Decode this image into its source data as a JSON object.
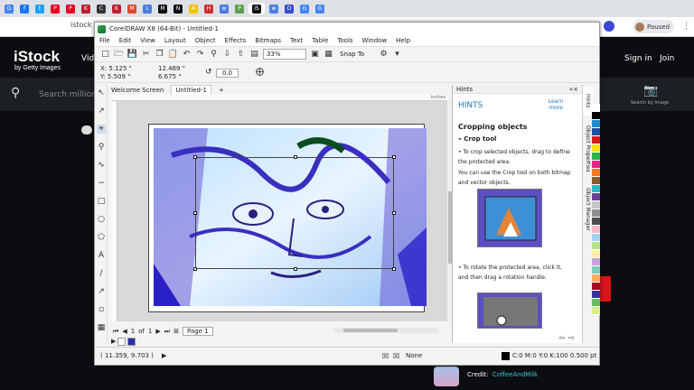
{
  "browser": {
    "tabs": [
      {
        "icon": "G",
        "color": "#4285f4"
      },
      {
        "icon": "f",
        "color": "#1877f2"
      },
      {
        "icon": "t",
        "color": "#1da1f2"
      },
      {
        "icon": "P",
        "color": "#e60023"
      },
      {
        "icon": "P",
        "color": "#e60023"
      },
      {
        "icon": "K",
        "color": "#bd2031"
      },
      {
        "icon": "C",
        "color": "#333333"
      },
      {
        "icon": "K",
        "color": "#bd2031"
      },
      {
        "icon": "M",
        "color": "#e1492a"
      },
      {
        "icon": "L",
        "color": "#4a7ee0"
      },
      {
        "icon": "M",
        "color": "#111111"
      },
      {
        "icon": "N",
        "color": "#111111"
      },
      {
        "icon": "A",
        "color": "#f2c200"
      },
      {
        "icon": "H",
        "color": "#cc2f2f"
      },
      {
        "icon": "w",
        "color": "#4a7ee0"
      },
      {
        "icon": "P",
        "color": "#5e9e4e"
      },
      {
        "icon": "iS",
        "color": "#111111"
      },
      {
        "icon": "w",
        "color": "#4a7ee0"
      },
      {
        "icon": "D",
        "color": "#3a4bd1"
      },
      {
        "icon": "G",
        "color": "#4285f4"
      },
      {
        "icon": "G",
        "color": "#4285f4"
      }
    ],
    "url": "istock",
    "profile_status": "Paused"
  },
  "istock": {
    "logo": "iStock",
    "logo_sub": "by Getty Images",
    "nav_partial": "Vid",
    "sign_in": "Sign in",
    "join": "Join",
    "search_placeholder": "Search millions",
    "search_by_image": "Search by image",
    "credit_label": "Credit:",
    "credit_name": "CoffeeAndMilk"
  },
  "app": {
    "title": "CorelDRAW X8 (64-Bit) - Untitled-1",
    "menu": [
      "File",
      "Edit",
      "View",
      "Layout",
      "Object",
      "Effects",
      "Bitmaps",
      "Text",
      "Table",
      "Tools",
      "Window",
      "Help"
    ],
    "zoom": "33%",
    "snap_to": "Snap To",
    "prop": {
      "x": "X: 5.125 \"",
      "y": "Y: 5.509 \"",
      "w": "12.469 \"",
      "h": "6.675 \"",
      "angle": "0.0"
    },
    "doc_tabs": [
      "Welcome Screen",
      "Untitled-1"
    ],
    "ruler_unit": "inches",
    "page_nav": {
      "current": "1",
      "of_label": "of",
      "total": "1",
      "page_tab": "Page 1"
    },
    "status": {
      "coords": "( 11.359, 9.703 )",
      "fill": "None",
      "outline": "C:0 M:0 Y:0 K:100  0.500 pt"
    }
  },
  "hints": {
    "panel_title": "Hints",
    "heading": "HINTS",
    "learn_more": "Learn more",
    "subtitle": "Cropping objects",
    "tool_name": "Crop tool",
    "p1": "• To crop selected objects, drag to define the protected area.",
    "p2": "You can use the Crop tool on both bitmap and vector objects.",
    "p3": "• To rotate the protected area, click it, and then drag a rotation handle."
  },
  "dockers": [
    "Hints",
    "Object Properties",
    "Object Manager"
  ],
  "palette": [
    "#ffffff",
    "#000000",
    "#1b8ccc",
    "#1f4fa8",
    "#d7191c",
    "#f7e11a",
    "#2db34a",
    "#e8208a",
    "#f47920",
    "#8b5a2b",
    "#2fb7c4",
    "#6f3f98",
    "#c6c6c6",
    "#8f8f8f",
    "#4d4d4d",
    "#f6b6c8",
    "#9fd3f0",
    "#b8e186",
    "#fff2a8",
    "#c9a0dc",
    "#7fcdbb",
    "#fdae61",
    "#a50026",
    "#313695",
    "#66bd63",
    "#d9ef8b"
  ]
}
